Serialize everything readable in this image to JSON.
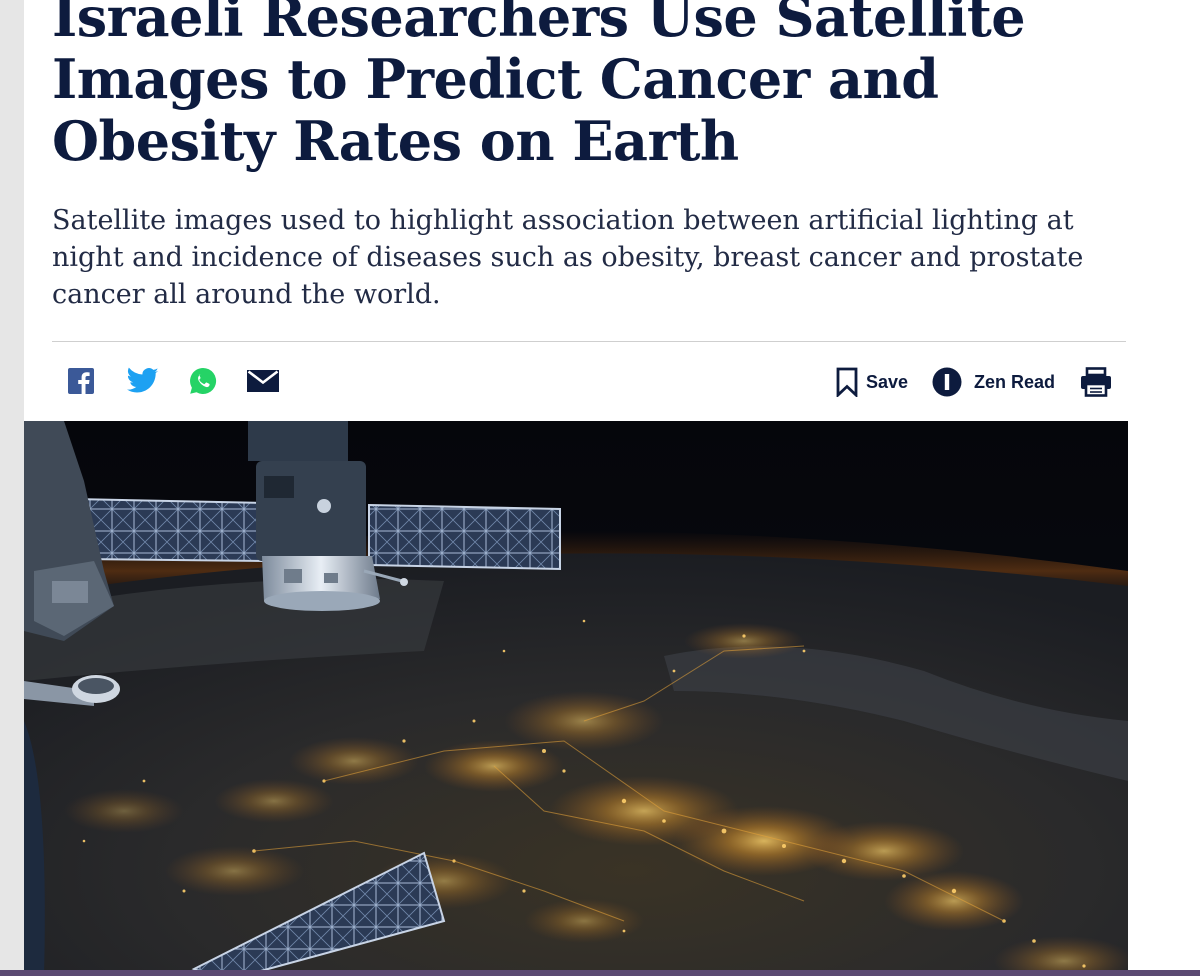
{
  "article": {
    "headline": "Israeli Researchers Use Satellite Images to Predict Cancer and Obesity Rates on Earth",
    "subheadline": "Satellite images used to highlight association between artificial lighting at night and incidence of diseases such as obesity, breast cancer and prostate cancer all around the world."
  },
  "toolbar": {
    "share_icons": [
      "facebook-icon",
      "twitter-icon",
      "whatsapp-icon",
      "email-icon"
    ],
    "save_label": "Save",
    "zen_read_label": "Zen Read",
    "print_icon": "printer-icon"
  },
  "colors": {
    "headline": "#0d1b3e",
    "facebook": "#3b5998",
    "twitter": "#1da1f2",
    "whatsapp": "#25d366"
  }
}
